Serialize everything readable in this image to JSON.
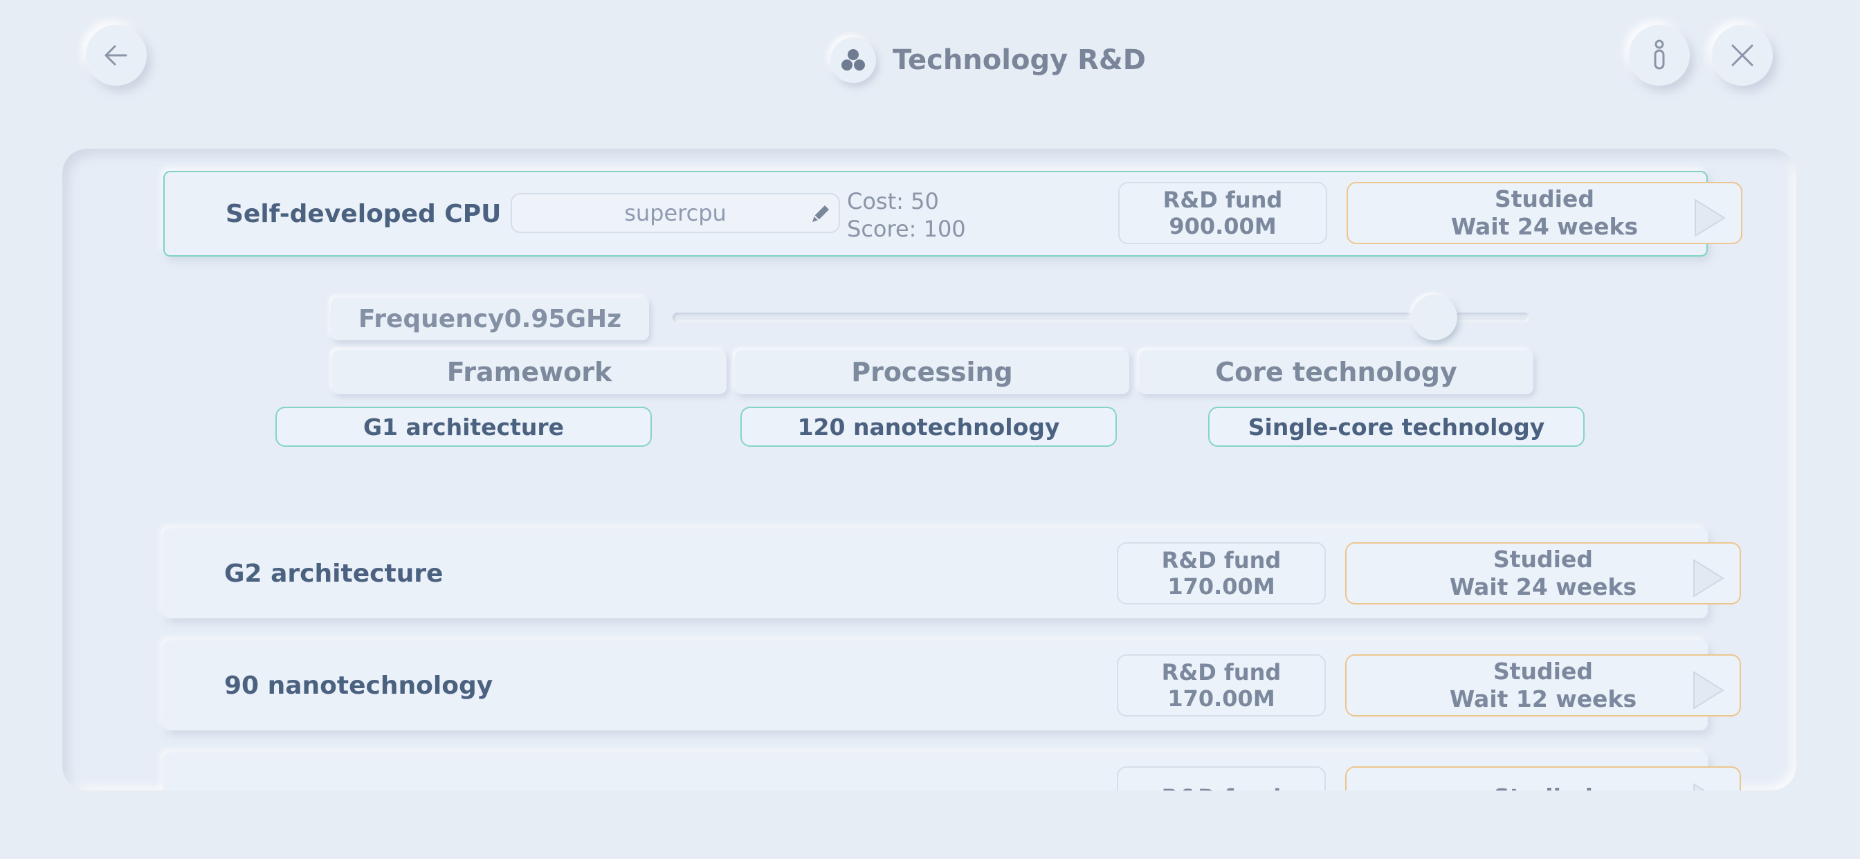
{
  "header": {
    "title": "Technology R&D",
    "back_icon": "arrow-left-icon",
    "info_icon": "info-icon",
    "close_icon": "close-icon",
    "title_icon": "tech-cluster-icon"
  },
  "cpu": {
    "name": "Self-developed CPU",
    "input_value": "supercpu",
    "cost": "Cost: 50",
    "score": "Score: 100",
    "fund_label": "R&D fund",
    "fund_value": "900.00M",
    "status": "Studied",
    "wait": "Wait 24 weeks"
  },
  "frequency": {
    "label": "Frequency0.95GHz",
    "slider_fraction": 0.89
  },
  "tabs": [
    "Framework",
    "Processing",
    "Core technology"
  ],
  "selected": [
    "G1 architecture",
    "120 nanotechnology",
    "Single-core technology"
  ],
  "items": [
    {
      "name": "G2 architecture",
      "fund_label": "R&D fund",
      "fund_value": "170.00M",
      "status": "Studied",
      "wait": "Wait 24 weeks"
    },
    {
      "name": "90 nanotechnology",
      "fund_label": "R&D fund",
      "fund_value": "170.00M",
      "status": "Studied",
      "wait": "Wait 12 weeks"
    },
    {
      "name": "",
      "fund_label": "R&D fund",
      "fund_value": "",
      "status": "Studied",
      "wait": ""
    }
  ],
  "colors": {
    "background": "#e7edf5",
    "accent_teal": "#7fd2c3",
    "accent_orange": "#edc58f",
    "text_dark": "#4b6180"
  }
}
